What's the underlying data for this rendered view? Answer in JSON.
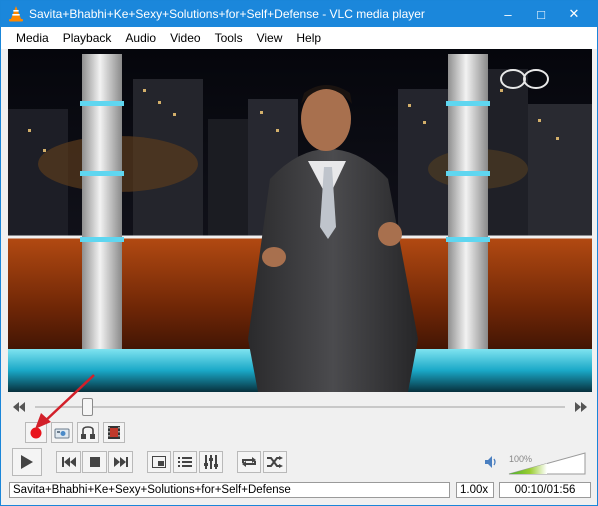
{
  "window": {
    "title": "Savita+Bhabhi+Ke+Sexy+Solutions+for+Self+Defense - VLC media player",
    "app_icon": "vlc-cone-icon",
    "controls": {
      "minimize": "–",
      "maximize": "□",
      "close": "✕"
    }
  },
  "menu": [
    "Media",
    "Playback",
    "Audio",
    "Video",
    "Tools",
    "View",
    "Help"
  ],
  "seek": {
    "position_fraction": 0.09
  },
  "advanced_controls": [
    {
      "icon": "record-icon",
      "accent": "#e8141c"
    },
    {
      "icon": "snapshot-icon"
    },
    {
      "icon": "loop-ab-icon"
    },
    {
      "icon": "frame-by-frame-icon"
    }
  ],
  "main_controls": {
    "play": "play-icon",
    "previous": "previous-icon",
    "stop": "stop-icon",
    "next": "next-icon",
    "fullscreen": "fullscreen-icon",
    "playlist": "playlist-icon",
    "extended": "equalizer-icon",
    "loop": "loop-icon",
    "shuffle": "shuffle-icon"
  },
  "volume": {
    "label": "100%",
    "level": 1.0,
    "icon": "speaker-icon",
    "accent": "#4cae2c"
  },
  "status": {
    "title": "Savita+Bhabhi+Ke+Sexy+Solutions+for+Self+Defense",
    "rate": "1.00x",
    "time": "00:10/01:56"
  },
  "annotation": {
    "color": "#d2202a"
  }
}
